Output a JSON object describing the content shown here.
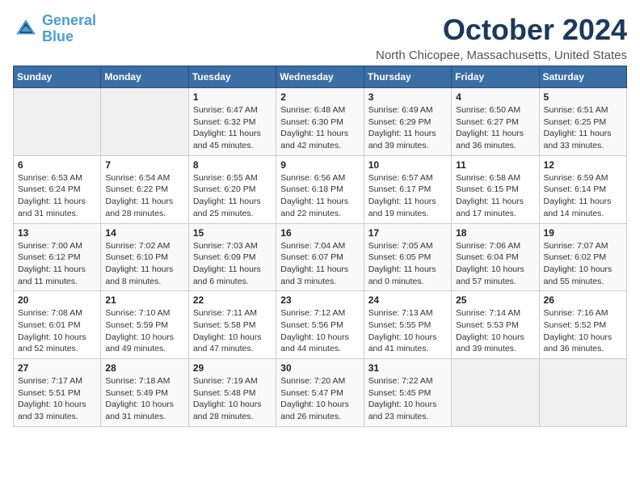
{
  "header": {
    "logo_line1": "General",
    "logo_line2": "Blue",
    "month": "October 2024",
    "location": "North Chicopee, Massachusetts, United States"
  },
  "weekdays": [
    "Sunday",
    "Monday",
    "Tuesday",
    "Wednesday",
    "Thursday",
    "Friday",
    "Saturday"
  ],
  "weeks": [
    [
      {
        "day": "",
        "info": ""
      },
      {
        "day": "",
        "info": ""
      },
      {
        "day": "1",
        "info": "Sunrise: 6:47 AM\nSunset: 6:32 PM\nDaylight: 11 hours\nand 45 minutes."
      },
      {
        "day": "2",
        "info": "Sunrise: 6:48 AM\nSunset: 6:30 PM\nDaylight: 11 hours\nand 42 minutes."
      },
      {
        "day": "3",
        "info": "Sunrise: 6:49 AM\nSunset: 6:29 PM\nDaylight: 11 hours\nand 39 minutes."
      },
      {
        "day": "4",
        "info": "Sunrise: 6:50 AM\nSunset: 6:27 PM\nDaylight: 11 hours\nand 36 minutes."
      },
      {
        "day": "5",
        "info": "Sunrise: 6:51 AM\nSunset: 6:25 PM\nDaylight: 11 hours\nand 33 minutes."
      }
    ],
    [
      {
        "day": "6",
        "info": "Sunrise: 6:53 AM\nSunset: 6:24 PM\nDaylight: 11 hours\nand 31 minutes."
      },
      {
        "day": "7",
        "info": "Sunrise: 6:54 AM\nSunset: 6:22 PM\nDaylight: 11 hours\nand 28 minutes."
      },
      {
        "day": "8",
        "info": "Sunrise: 6:55 AM\nSunset: 6:20 PM\nDaylight: 11 hours\nand 25 minutes."
      },
      {
        "day": "9",
        "info": "Sunrise: 6:56 AM\nSunset: 6:18 PM\nDaylight: 11 hours\nand 22 minutes."
      },
      {
        "day": "10",
        "info": "Sunrise: 6:57 AM\nSunset: 6:17 PM\nDaylight: 11 hours\nand 19 minutes."
      },
      {
        "day": "11",
        "info": "Sunrise: 6:58 AM\nSunset: 6:15 PM\nDaylight: 11 hours\nand 17 minutes."
      },
      {
        "day": "12",
        "info": "Sunrise: 6:59 AM\nSunset: 6:14 PM\nDaylight: 11 hours\nand 14 minutes."
      }
    ],
    [
      {
        "day": "13",
        "info": "Sunrise: 7:00 AM\nSunset: 6:12 PM\nDaylight: 11 hours\nand 11 minutes."
      },
      {
        "day": "14",
        "info": "Sunrise: 7:02 AM\nSunset: 6:10 PM\nDaylight: 11 hours\nand 8 minutes."
      },
      {
        "day": "15",
        "info": "Sunrise: 7:03 AM\nSunset: 6:09 PM\nDaylight: 11 hours\nand 6 minutes."
      },
      {
        "day": "16",
        "info": "Sunrise: 7:04 AM\nSunset: 6:07 PM\nDaylight: 11 hours\nand 3 minutes."
      },
      {
        "day": "17",
        "info": "Sunrise: 7:05 AM\nSunset: 6:05 PM\nDaylight: 11 hours\nand 0 minutes."
      },
      {
        "day": "18",
        "info": "Sunrise: 7:06 AM\nSunset: 6:04 PM\nDaylight: 10 hours\nand 57 minutes."
      },
      {
        "day": "19",
        "info": "Sunrise: 7:07 AM\nSunset: 6:02 PM\nDaylight: 10 hours\nand 55 minutes."
      }
    ],
    [
      {
        "day": "20",
        "info": "Sunrise: 7:08 AM\nSunset: 6:01 PM\nDaylight: 10 hours\nand 52 minutes."
      },
      {
        "day": "21",
        "info": "Sunrise: 7:10 AM\nSunset: 5:59 PM\nDaylight: 10 hours\nand 49 minutes."
      },
      {
        "day": "22",
        "info": "Sunrise: 7:11 AM\nSunset: 5:58 PM\nDaylight: 10 hours\nand 47 minutes."
      },
      {
        "day": "23",
        "info": "Sunrise: 7:12 AM\nSunset: 5:56 PM\nDaylight: 10 hours\nand 44 minutes."
      },
      {
        "day": "24",
        "info": "Sunrise: 7:13 AM\nSunset: 5:55 PM\nDaylight: 10 hours\nand 41 minutes."
      },
      {
        "day": "25",
        "info": "Sunrise: 7:14 AM\nSunset: 5:53 PM\nDaylight: 10 hours\nand 39 minutes."
      },
      {
        "day": "26",
        "info": "Sunrise: 7:16 AM\nSunset: 5:52 PM\nDaylight: 10 hours\nand 36 minutes."
      }
    ],
    [
      {
        "day": "27",
        "info": "Sunrise: 7:17 AM\nSunset: 5:51 PM\nDaylight: 10 hours\nand 33 minutes."
      },
      {
        "day": "28",
        "info": "Sunrise: 7:18 AM\nSunset: 5:49 PM\nDaylight: 10 hours\nand 31 minutes."
      },
      {
        "day": "29",
        "info": "Sunrise: 7:19 AM\nSunset: 5:48 PM\nDaylight: 10 hours\nand 28 minutes."
      },
      {
        "day": "30",
        "info": "Sunrise: 7:20 AM\nSunset: 5:47 PM\nDaylight: 10 hours\nand 26 minutes."
      },
      {
        "day": "31",
        "info": "Sunrise: 7:22 AM\nSunset: 5:45 PM\nDaylight: 10 hours\nand 23 minutes."
      },
      {
        "day": "",
        "info": ""
      },
      {
        "day": "",
        "info": ""
      }
    ]
  ]
}
